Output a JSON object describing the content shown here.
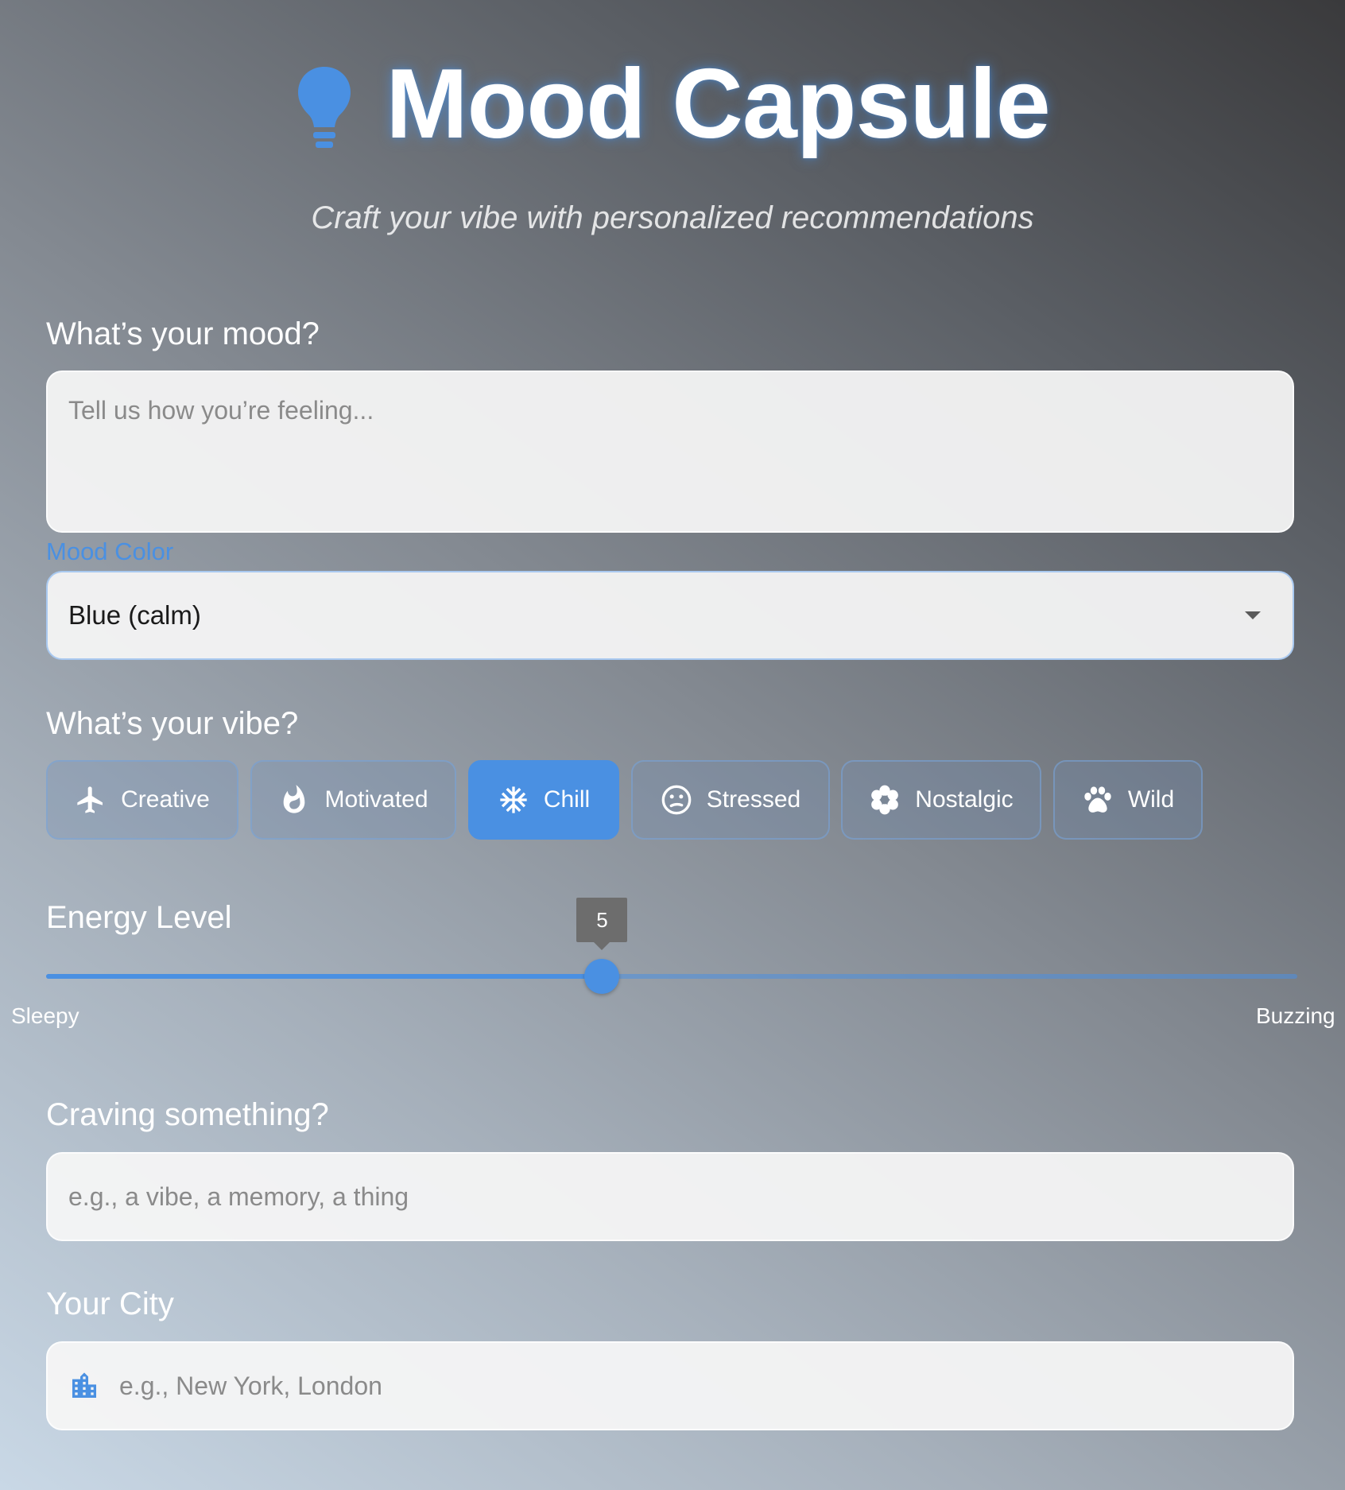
{
  "header": {
    "title": "Mood Capsule",
    "subtitle": "Craft your vibe with personalized recommendations",
    "icon": "lightbulb-icon"
  },
  "mood": {
    "label": "What’s your mood?",
    "placeholder": "Tell us how you’re feeling..."
  },
  "mood_color": {
    "label": "Mood Color",
    "value": "Blue (calm)"
  },
  "vibe": {
    "label": "What’s your vibe?",
    "options": [
      {
        "label": "Creative",
        "icon": "airplane-icon"
      },
      {
        "label": "Motivated",
        "icon": "flame-icon"
      },
      {
        "label": "Chill",
        "icon": "snowflake-icon"
      },
      {
        "label": "Stressed",
        "icon": "meh-face-icon"
      },
      {
        "label": "Nostalgic",
        "icon": "flower-icon"
      },
      {
        "label": "Wild",
        "icon": "paw-icon"
      }
    ],
    "selected": "Chill"
  },
  "energy": {
    "label": "Energy Level",
    "value": "5",
    "fraction": 0.4444,
    "min_label": "Sleepy",
    "max_label": "Buzzing"
  },
  "craving": {
    "label": "Craving something?",
    "placeholder": "e.g., a vibe, a memory, a thing"
  },
  "city": {
    "label": "Your City",
    "placeholder": "e.g., New York, London",
    "icon": "city-building-icon"
  },
  "colors": {
    "accent": "#4a90e2",
    "tooltip": "#6d6d6d"
  }
}
